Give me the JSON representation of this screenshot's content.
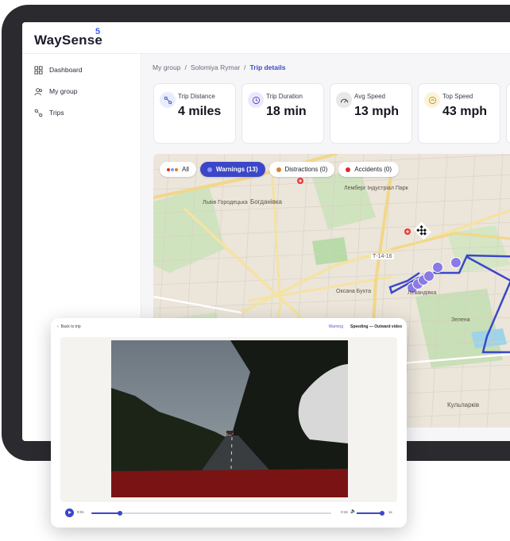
{
  "brand": {
    "name": "WaySense",
    "mark": "5"
  },
  "sidebar": {
    "items": [
      {
        "label": "Dashboard",
        "icon": "grid-icon"
      },
      {
        "label": "My group",
        "icon": "users-icon"
      },
      {
        "label": "Trips",
        "icon": "route-icon"
      }
    ]
  },
  "breadcrumb": {
    "items": [
      "My group",
      "Solomiya Rymar",
      "Trip details"
    ],
    "separator": "/"
  },
  "stats": [
    {
      "label": "Trip Distance",
      "value": "4 miles",
      "icon": "route-icon",
      "color": "#e8ecfb"
    },
    {
      "label": "Trip Duration",
      "value": "18 min",
      "icon": "clock-icon",
      "color": "#ece8fb"
    },
    {
      "label": "Avg Speed",
      "value": "13 mph",
      "icon": "speedometer-icon",
      "color": "#ececec"
    },
    {
      "label": "Top Speed",
      "value": "43 mph",
      "icon": "speed-icon",
      "color": "#fbf3d9"
    }
  ],
  "filters": [
    {
      "label": "All",
      "dot": "multi"
    },
    {
      "label": "Warnings (13)",
      "dot": "#8a95ff",
      "active": true
    },
    {
      "label": "Distractions (0)",
      "dot": "#d9822b"
    },
    {
      "label": "Accidents (0)",
      "dot": "#d92b2b"
    }
  ],
  "map": {
    "labels": [
      "Богданівка",
      "Львів Городецька",
      "Левандівка",
      "Лемберг Індустріал Парк",
      "Оксана Бухта",
      "Т-14-16",
      "Кульпарків",
      "Зелена"
    ],
    "route_color": "#3b47c8",
    "marker_color": "#8a7ae6"
  },
  "video": {
    "back_label": "Back to trip",
    "tag": "Warning",
    "title": "Speeding — Outward video",
    "time_current": "0:01",
    "time_total": "0:15",
    "speed": "1x",
    "progress": 0.12
  }
}
